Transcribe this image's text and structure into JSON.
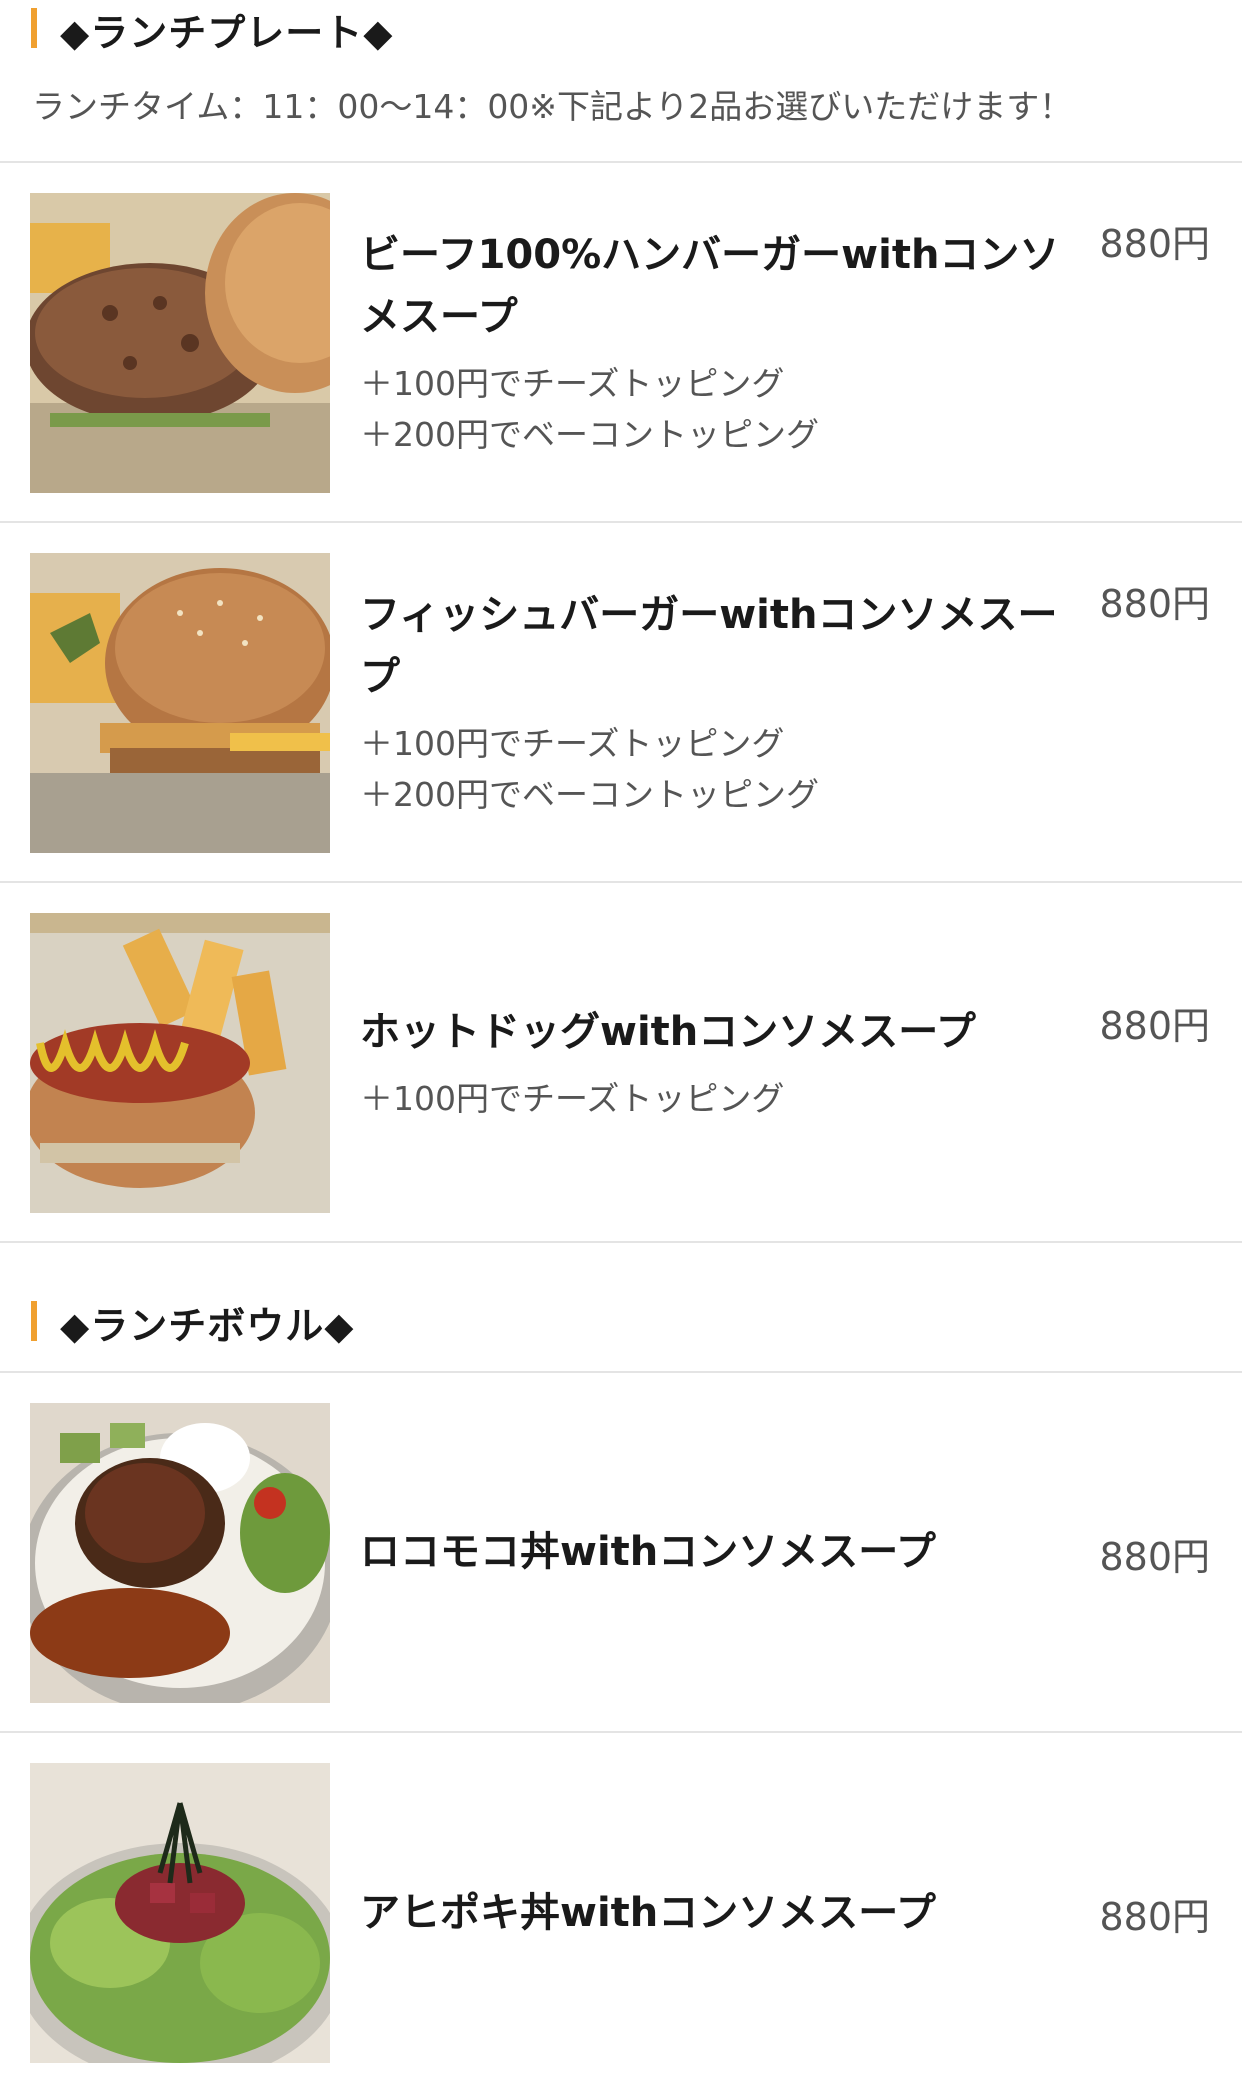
{
  "sections": [
    {
      "title": "◆ランチプレート◆",
      "note": "ランチタイム：11：00〜14：00※下記より2品お選びいただけます！",
      "items": [
        {
          "name": "ビーフ100%ハンバーガーwithコンソメスープ",
          "price": "880円",
          "notes": [
            "＋100円でチーズトッピング",
            "＋200円でベーコントッピング"
          ],
          "image": "beef-burger-image"
        },
        {
          "name": "フィッシュバーガーwithコンソメスープ",
          "price": "880円",
          "notes": [
            "＋100円でチーズトッピング",
            "＋200円でベーコントッピング"
          ],
          "image": "fish-burger-image"
        },
        {
          "name": "ホットドッグwithコンソメスープ",
          "price": "880円",
          "notes": [
            "＋100円でチーズトッピング"
          ],
          "image": "hotdog-image"
        }
      ]
    },
    {
      "title": "◆ランチボウル◆",
      "items": [
        {
          "name": "ロコモコ丼withコンソメスープ",
          "price": "880円",
          "notes": [],
          "image": "loco-moco-image"
        },
        {
          "name": "アヒポキ丼withコンソメスープ",
          "price": "880円",
          "notes": [],
          "image": "ahi-poke-image"
        }
      ]
    }
  ],
  "colors": {
    "accent_bar": "#f0a030",
    "divider": "#e4e4e4",
    "subtext": "#555555"
  }
}
